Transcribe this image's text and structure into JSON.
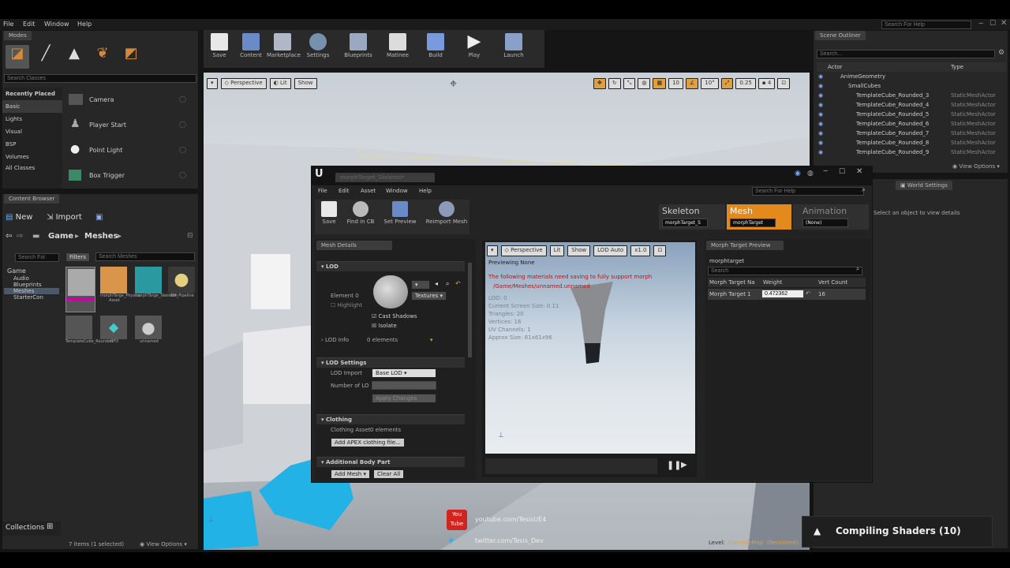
{
  "menu": {
    "items": [
      "File",
      "Edit",
      "Window",
      "Help"
    ],
    "search_placeholder": "Search For Help"
  },
  "modes": {
    "tab": "Modes",
    "search_placeholder": "Search Classes",
    "categories": [
      "Recently Placed",
      "Basic",
      "Lights",
      "Visual",
      "BSP",
      "Volumes",
      "All Classes"
    ],
    "items": [
      "Camera",
      "Player Start",
      "Point Light",
      "Box Trigger"
    ]
  },
  "toolbar": {
    "buttons": [
      "Save",
      "Content",
      "Marketplace",
      "Settings",
      "Blueprints",
      "Matinee",
      "Build",
      "Play",
      "Launch"
    ]
  },
  "viewport": {
    "perspective": "Perspective",
    "lit": "Lit",
    "show": "Show",
    "snap_grid": "10",
    "snap_rot": "10°",
    "snap_scale": "0.25",
    "cam_speed": "4",
    "level_label": "Level:",
    "level_name": "ExampleMap",
    "level_tag": "(Persistent)"
  },
  "content_browser": {
    "tab": "Content Browser",
    "new": "New",
    "import": "Import",
    "path": [
      "Game",
      "Meshes"
    ],
    "search_placeholder": "Search Fol",
    "filters": "Filters",
    "search_assets": "Search Meshes",
    "tree": [
      "Game",
      "Audio",
      "Blueprints",
      "Meshes",
      "StarterCon"
    ],
    "assets": [
      "",
      "morphTarge_Physics Asset",
      "morphTarge_Skeleton",
      "SM_Pipeline",
      "TemplateCube_Rounded",
      "UFO",
      "unnamed"
    ],
    "status": "7 items (1 selected)",
    "view_options": "View Options",
    "collections": "Collections"
  },
  "outliner": {
    "tab": "Scene Outliner",
    "search_placeholder": "Search...",
    "col_actor": "Actor",
    "col_type": "Type",
    "rows": [
      {
        "name": "AnimeGeometry",
        "type": ""
      },
      {
        "name": "SmallCubes",
        "type": ""
      },
      {
        "name": "TemplateCube_Rounded_3",
        "type": "StaticMeshActor"
      },
      {
        "name": "TemplateCube_Rounded_4",
        "type": "StaticMeshActor"
      },
      {
        "name": "TemplateCube_Rounded_5",
        "type": "StaticMeshActor"
      },
      {
        "name": "TemplateCube_Rounded_6",
        "type": "StaticMeshActor"
      },
      {
        "name": "TemplateCube_Rounded_7",
        "type": "StaticMeshActor"
      },
      {
        "name": "TemplateCube_Rounded_8",
        "type": "StaticMeshActor"
      },
      {
        "name": "TemplateCube_Rounded_9",
        "type": "StaticMeshActor"
      }
    ],
    "view_options": "View Options",
    "world_settings": "World Settings",
    "select_hint": "Select an object to view details"
  },
  "persona": {
    "tab": "morphTarget_Skeleton*",
    "menu": [
      "File",
      "Edit",
      "Asset",
      "Window",
      "Help"
    ],
    "search_placeholder": "Search For Help",
    "toolbar": [
      "Save",
      "Find in CB",
      "Set Preview",
      "Reimport Mesh"
    ],
    "modes": {
      "skeleton": "Skeleton",
      "skeleton_value": "morphTarget_S",
      "mesh": "Mesh",
      "mesh_value": "morphTarget",
      "animation": "Animation",
      "animation_value": "(None)"
    },
    "mesh_details": {
      "tab": "Mesh Details",
      "lod": "LOD",
      "element": "Element 0",
      "highlight": "Highlight",
      "textures": "Textures",
      "cast_shadows": "Cast Shadows",
      "isolate": "Isolate",
      "lod_info": "LOD Info",
      "elements": "0 elements",
      "lod_settings": "LOD Settings",
      "lod_import": "LOD Import",
      "lod_import_value": "Base LOD",
      "num_lods": "Number of LO",
      "apply": "Apply Changes",
      "clothing": "Clothing",
      "clothing_asset": "Clothing Asset",
      "clothing_elements": "0 elements",
      "add_apex": "Add APEX clothing file...",
      "additional": "Additional Body Part",
      "add_mesh": "Add Mesh",
      "clear_all": "Clear All"
    },
    "preview": {
      "perspective": "Perspective",
      "lit": "Lit",
      "show": "Show",
      "lod": "LOD Auto",
      "speed": "x1.0",
      "title": "Previewing None",
      "warning": "The following materials need saving to fully support morph",
      "warning_path": "/Game/Meshes/unnamed.unnamed",
      "stats": [
        "LOD: 0",
        "Current Screen Size: 0.11",
        "Triangles: 20",
        "Vertices: 16",
        "UV Channels: 1",
        "Approx Size: 61x61x96"
      ]
    },
    "morph": {
      "tab": "Morph Target Preview",
      "name": "morphtarget",
      "search_placeholder": "Search",
      "col_name": "Morph Target Na",
      "col_weight": "Weight",
      "col_verts": "Vert Count",
      "row_name": "Morph Target 1",
      "row_weight": "0.472362",
      "row_verts": "16"
    }
  },
  "overlay": {
    "youtube": "youtube.com/TesisUE4",
    "twitter": "twitter.com/Tesis_Dev",
    "compiling": "Compiling Shaders (10)"
  }
}
